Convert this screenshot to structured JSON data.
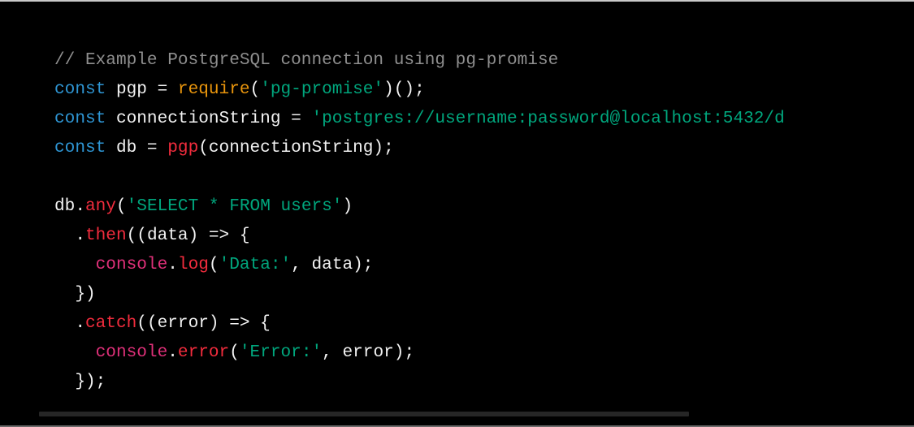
{
  "code_block": {
    "language": "javascript",
    "lines": [
      [
        {
          "t": "comment",
          "v": "// Example PostgreSQL connection using pg-promise"
        }
      ],
      [
        {
          "t": "keyword",
          "v": "const"
        },
        {
          "t": "plain",
          "v": " pgp = "
        },
        {
          "t": "builtin",
          "v": "require"
        },
        {
          "t": "plain",
          "v": "("
        },
        {
          "t": "string",
          "v": "'pg-promise'"
        },
        {
          "t": "plain",
          "v": ")();"
        }
      ],
      [
        {
          "t": "keyword",
          "v": "const"
        },
        {
          "t": "plain",
          "v": " connectionString = "
        },
        {
          "t": "string",
          "v": "'postgres://username:password@localhost:5432/d"
        }
      ],
      [
        {
          "t": "keyword",
          "v": "const"
        },
        {
          "t": "plain",
          "v": " db = "
        },
        {
          "t": "method",
          "v": "pgp"
        },
        {
          "t": "plain",
          "v": "(connectionString);"
        }
      ],
      [],
      [
        {
          "t": "plain",
          "v": "db."
        },
        {
          "t": "method",
          "v": "any"
        },
        {
          "t": "plain",
          "v": "("
        },
        {
          "t": "string",
          "v": "'SELECT * FROM users'"
        },
        {
          "t": "plain",
          "v": ")"
        }
      ],
      [
        {
          "t": "plain",
          "v": "  ."
        },
        {
          "t": "method",
          "v": "then"
        },
        {
          "t": "plain",
          "v": "((data) => {"
        }
      ],
      [
        {
          "t": "plain",
          "v": "    "
        },
        {
          "t": "func",
          "v": "console"
        },
        {
          "t": "plain",
          "v": "."
        },
        {
          "t": "method",
          "v": "log"
        },
        {
          "t": "plain",
          "v": "("
        },
        {
          "t": "string",
          "v": "'Data:'"
        },
        {
          "t": "plain",
          "v": ", data);"
        }
      ],
      [
        {
          "t": "plain",
          "v": "  })"
        }
      ],
      [
        {
          "t": "plain",
          "v": "  ."
        },
        {
          "t": "method",
          "v": "catch"
        },
        {
          "t": "plain",
          "v": "((error) => {"
        }
      ],
      [
        {
          "t": "plain",
          "v": "    "
        },
        {
          "t": "func",
          "v": "console"
        },
        {
          "t": "plain",
          "v": "."
        },
        {
          "t": "method",
          "v": "error"
        },
        {
          "t": "plain",
          "v": "("
        },
        {
          "t": "string",
          "v": "'Error:'"
        },
        {
          "t": "plain",
          "v": ", error);"
        }
      ],
      [
        {
          "t": "plain",
          "v": "  });"
        }
      ]
    ]
  },
  "colors": {
    "background": "#000000",
    "comment": "#8f8f8f",
    "keyword": "#2e95d3",
    "plain": "#f2f2f2",
    "builtin": "#e9950c",
    "string": "#00a67d",
    "function": "#df3079",
    "method": "#f22c3d",
    "scrollbar": "#262626"
  },
  "icons": {
    "scrollbar": "horizontal-scrollbar"
  }
}
